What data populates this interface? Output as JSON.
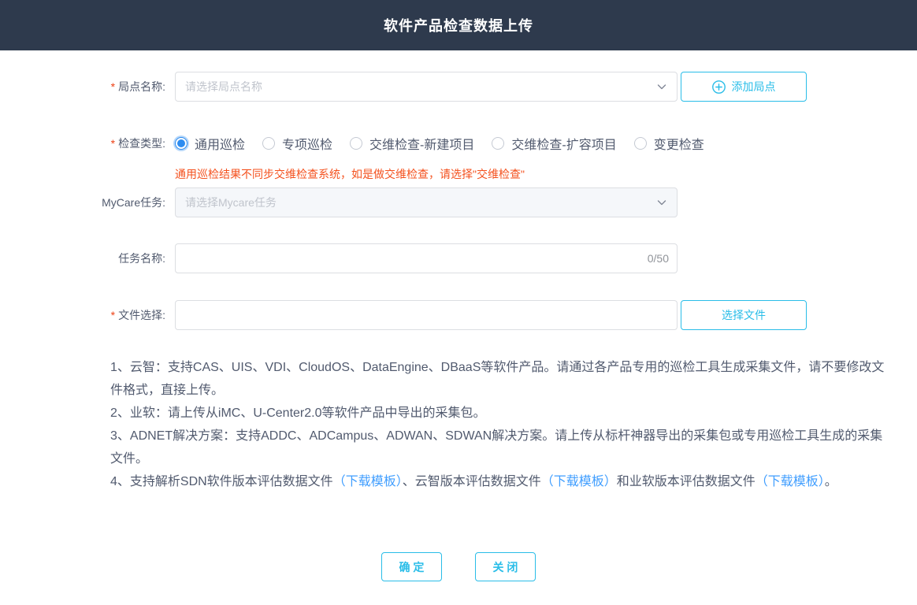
{
  "header": {
    "title": "软件产品检查数据上传"
  },
  "colors": {
    "header_bg": "#2e3a4d",
    "accent_cyan": "#29bde8",
    "radio_blue": "#2d8cf0",
    "warning_orange": "#f4511e",
    "link_blue": "#409eff",
    "required_red": "#ed4014"
  },
  "form": {
    "site": {
      "required": "*",
      "label": "局点名称:",
      "placeholder": "请选择局点名称",
      "add_button_label": "添加局点"
    },
    "check_type": {
      "required": "*",
      "label": "检查类型:",
      "options": [
        {
          "label": "通用巡检",
          "selected": true
        },
        {
          "label": "专项巡检",
          "selected": false
        },
        {
          "label": "交维检查-新建项目",
          "selected": false
        },
        {
          "label": "交维检查-扩容项目",
          "selected": false
        },
        {
          "label": "变更检查",
          "selected": false
        }
      ],
      "warning": "通用巡检结果不同步交维检查系统，如是做交维检查，请选择\"交维检查\""
    },
    "mycare": {
      "label": "MyCare任务:",
      "placeholder": "请选择Mycare任务"
    },
    "task_name": {
      "label": "任务名称:",
      "value": "",
      "counter": "0/50"
    },
    "file": {
      "required": "*",
      "label": "文件选择:",
      "value": "",
      "button_label": "选择文件"
    }
  },
  "instructions": {
    "item1": "1、云智：支持CAS、UIS、VDI、CloudOS、DataEngine、DBaaS等软件产品。请通过各产品专用的巡检工具生成采集文件，请不要修改文件格式，直接上传。",
    "item2": "2、业软：请上传从iMC、U-Center2.0等软件产品中导出的采集包。",
    "item3": "3、ADNET解决方案：支持ADDC、ADCampus、ADWAN、SDWAN解决方案。请上传从标杆神器导出的采集包或专用巡检工具生成的采集文件。",
    "item4": {
      "part1": "4、支持解析SDN软件版本评估数据文件",
      "link1": "（下载模板）",
      "part2": "、云智版本评估数据文件",
      "link2": "（下载模板）",
      "part3": "和业软版本评估数据文件",
      "link3": "（下载模板）",
      "part4": "。"
    }
  },
  "footer": {
    "confirm_label": "确 定",
    "close_label": "关 闭"
  }
}
